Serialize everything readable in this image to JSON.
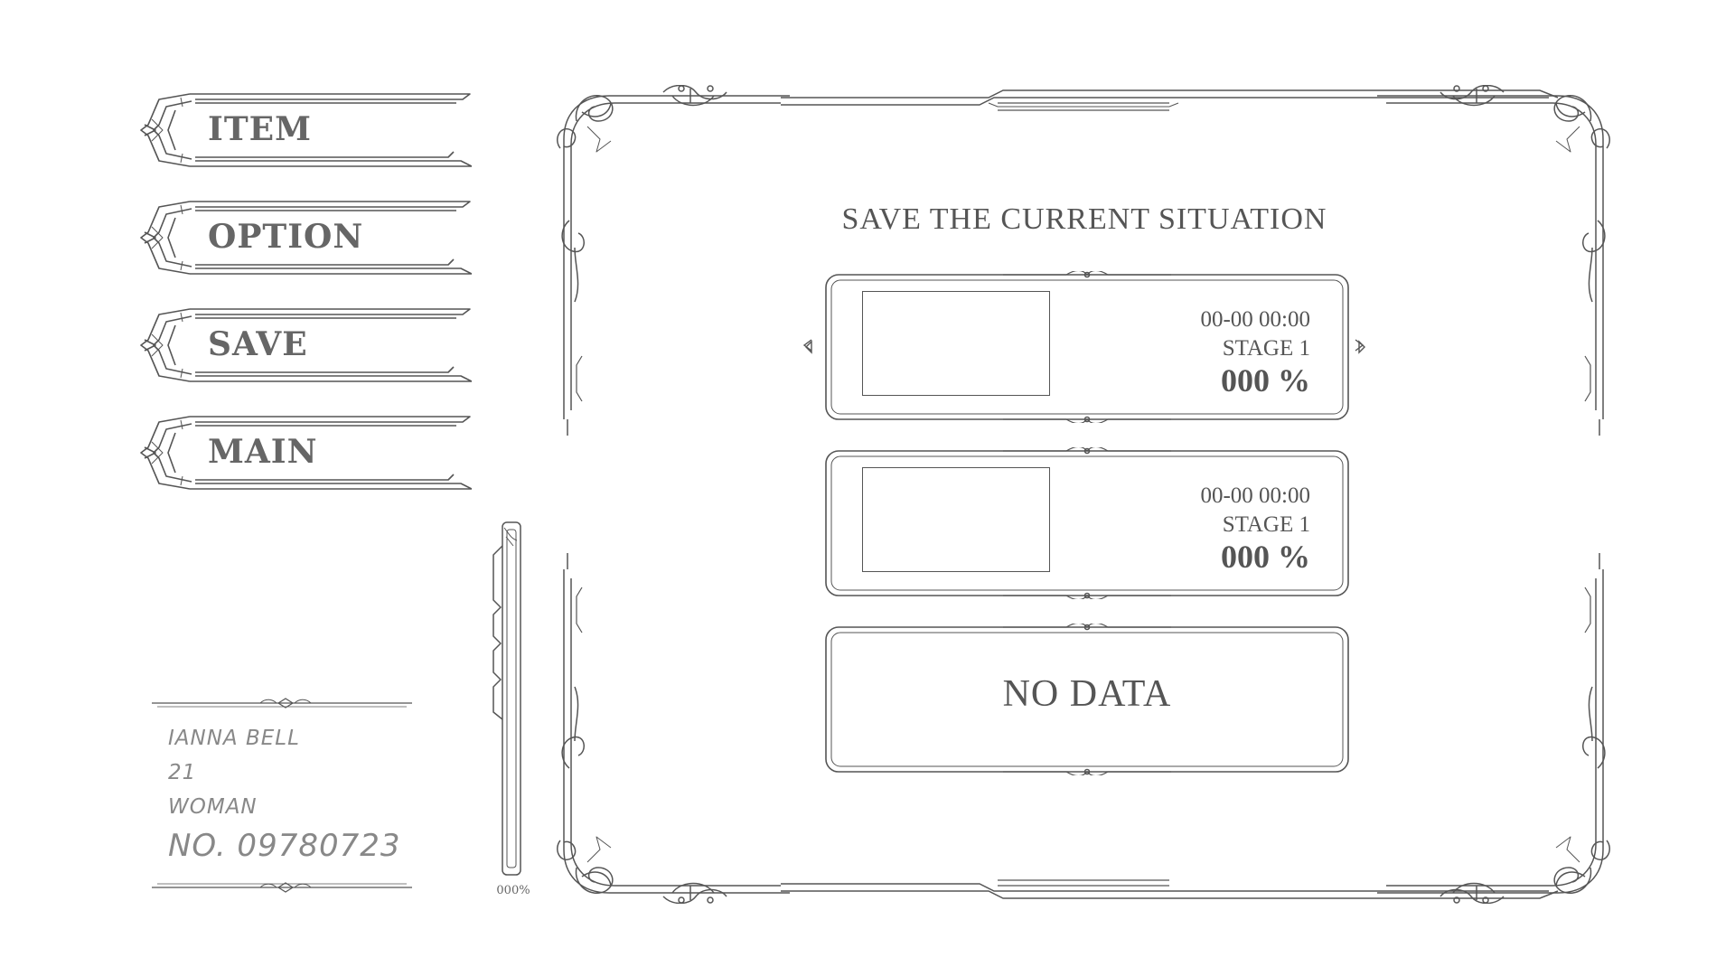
{
  "menu": {
    "items": [
      {
        "id": "item",
        "label": "ITEM"
      },
      {
        "id": "option",
        "label": "OPTION"
      },
      {
        "id": "save",
        "label": "SAVE"
      },
      {
        "id": "main",
        "label": "MAIN"
      }
    ]
  },
  "profile": {
    "name": "IANNA BELL",
    "age": "21",
    "gender": "WOMAN",
    "number": "NO. 09780723"
  },
  "gauge": {
    "label": "000%",
    "fill_fraction": 0.0
  },
  "panel": {
    "title": "SAVE THE CURRENT SITUATION",
    "slots": [
      {
        "date": "00-00 00:00",
        "stage": "STAGE 1",
        "progress": "000 %"
      },
      {
        "date": "00-00 00:00",
        "stage": "STAGE 1",
        "progress": "000 %"
      },
      {
        "empty_label": "NO DATA"
      }
    ]
  },
  "colors": {
    "line": "#555555",
    "text": "#555555",
    "background": "#ffffff"
  },
  "icons": {
    "arrow-left": "small-left-triangle-icon",
    "arrow-right": "small-right-triangle-icon"
  }
}
